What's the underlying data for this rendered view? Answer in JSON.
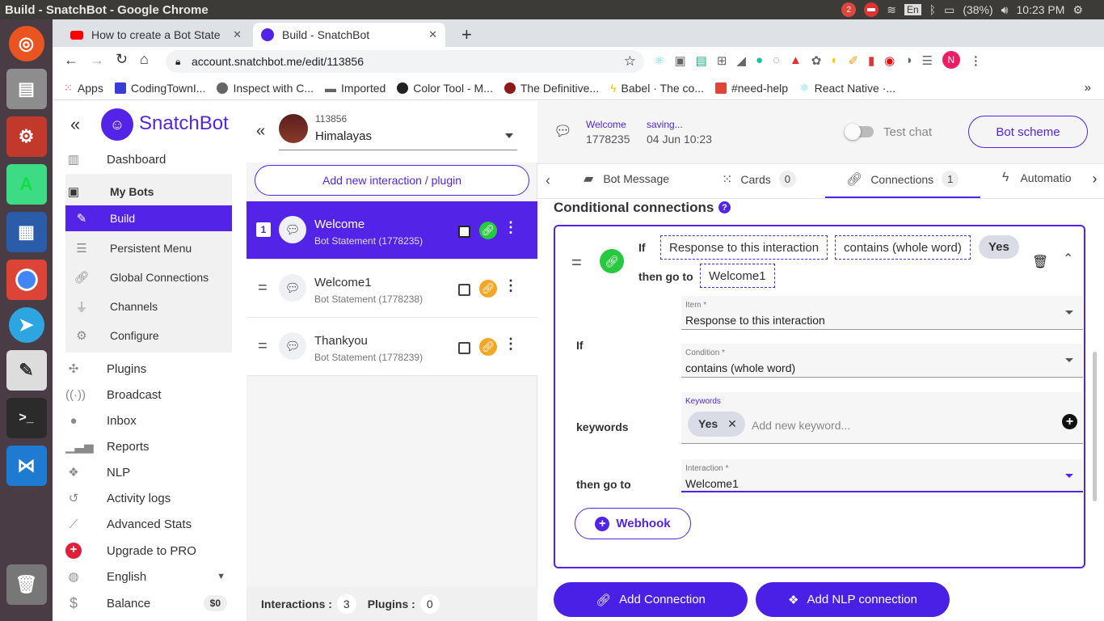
{
  "os": {
    "window_title": "Build - SnatchBot - Google Chrome",
    "notif_count": "2",
    "lang": "En",
    "battery": "(38%)",
    "clock": "10:23 PM"
  },
  "browser": {
    "tabs": [
      {
        "title": "How to create a Bot State"
      },
      {
        "title": "Build - SnatchBot"
      }
    ],
    "url": "account.snatchbot.me/edit/113856",
    "bookmarks": [
      "Apps",
      "CodingTownI...",
      "Inspect with C...",
      "Imported",
      "Color Tool - M...",
      "The Definitive...",
      "Babel · The co...",
      "#need-help",
      "React Native ·..."
    ],
    "more": "»",
    "profile": "N"
  },
  "sidebar": {
    "brand": "SnatchBot",
    "collapse": "«",
    "items": [
      {
        "label": "Dashboard"
      },
      {
        "label": "My Bots"
      },
      {
        "label": "Build"
      },
      {
        "label": "Persistent Menu"
      },
      {
        "label": "Global Connections"
      },
      {
        "label": "Channels"
      },
      {
        "label": "Configure"
      },
      {
        "label": "Plugins"
      },
      {
        "label": "Broadcast"
      },
      {
        "label": "Inbox"
      },
      {
        "label": "Reports"
      },
      {
        "label": "NLP"
      },
      {
        "label": "Activity logs"
      },
      {
        "label": "Advanced Stats"
      },
      {
        "label": "Upgrade to PRO"
      },
      {
        "label": "English"
      },
      {
        "label": "Balance"
      }
    ],
    "balance": "$0"
  },
  "botpanel": {
    "collapse": "«",
    "bot_id": "113856",
    "bot_name": "Himalayas",
    "add_btn": "Add new interaction / plugin",
    "rows": [
      {
        "num": "1",
        "title": "Welcome",
        "sub": "Bot Statement (1778235)"
      },
      {
        "title": "Welcome1",
        "sub": "Bot Statement (1778238)"
      },
      {
        "title": "Thankyou",
        "sub": "Bot Statement (1778239)"
      }
    ],
    "footer": {
      "interactions_label": "Interactions :",
      "interactions": "3",
      "plugins_label": "Plugins :",
      "plugins": "0"
    }
  },
  "editor": {
    "name": "Welcome",
    "id": "1778235",
    "status": "saving...",
    "date": "04 Jun 10:23",
    "test_chat": "Test chat",
    "bot_scheme": "Bot scheme",
    "tabs": [
      {
        "label": "Bot Message"
      },
      {
        "label": "Cards",
        "count": "0"
      },
      {
        "label": "Connections",
        "count": "1"
      },
      {
        "label": "Automatio"
      }
    ],
    "section_title": "Conditional connections",
    "help": "?",
    "rule": {
      "if": "If",
      "item": "Response to this interaction",
      "condition": "contains (whole word)",
      "keyword": "Yes",
      "then": "then go to",
      "target": "Welcome1"
    },
    "form": {
      "if_label": "If",
      "item_label": "Item *",
      "item_value": "Response to this interaction",
      "cond_label": "Condition *",
      "cond_value": "contains (whole word)",
      "kw_section": "keywords",
      "kw_label": "Keywords",
      "kw_chip": "Yes",
      "kw_placeholder": "Add new keyword...",
      "goto_label": "then go to",
      "inter_label": "Interaction *",
      "inter_value": "Welcome1",
      "webhook": "Webhook"
    },
    "add_connection": "Add Connection",
    "add_nlp": "Add NLP connection"
  },
  "colors": {
    "accent": "#5324e8",
    "ubuntu_bar": "#3c3b37",
    "launcher": "#4a3c45",
    "link_green": "#27c93f",
    "link_orange": "#f5a623"
  }
}
